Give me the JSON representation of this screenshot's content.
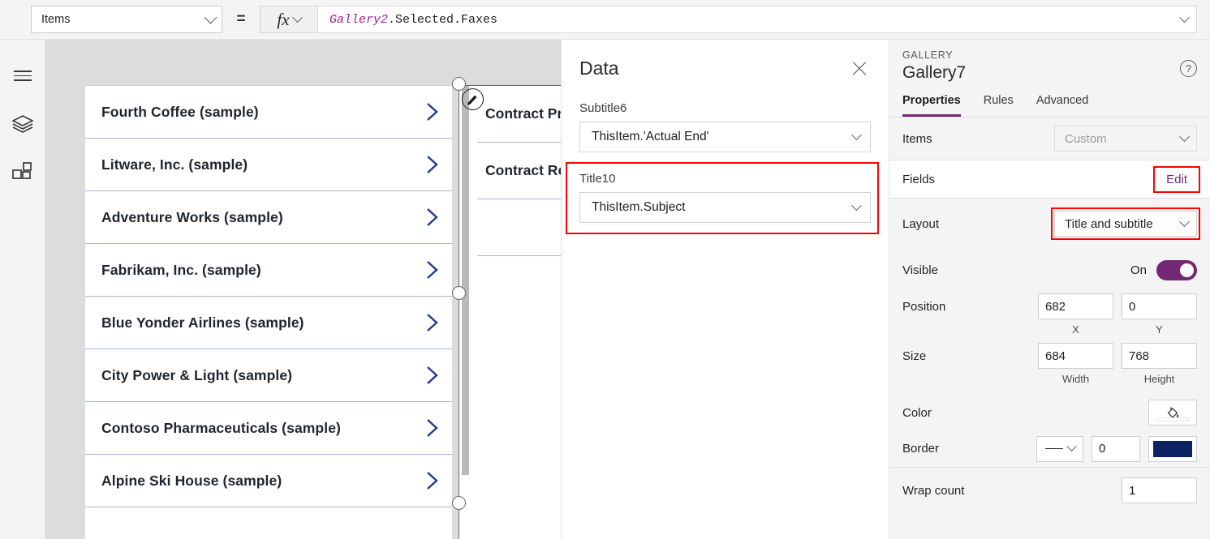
{
  "formula_bar": {
    "property_selector": {
      "value": "Items",
      "icon": "chevron-down-icon"
    },
    "equals": "=",
    "fx_label": "fx",
    "formula": {
      "object": "Gallery2",
      "rest": ".Selected.Faxes"
    }
  },
  "left_rail": {
    "items": [
      {
        "icon": "hamburger-menu-icon",
        "name": "menu"
      },
      {
        "icon": "layers-icon",
        "name": "screens"
      },
      {
        "icon": "components-grid-icon",
        "name": "components"
      }
    ]
  },
  "canvas": {
    "gallery1": {
      "items": [
        {
          "title": "Fourth Coffee (sample)"
        },
        {
          "title": "Litware, Inc. (sample)"
        },
        {
          "title": "Adventure Works (sample)"
        },
        {
          "title": "Fabrikam, Inc. (sample)"
        },
        {
          "title": "Blue Yonder Airlines (sample)"
        },
        {
          "title": "City Power & Light (sample)"
        },
        {
          "title": "Contoso Pharmaceuticals (sample)"
        },
        {
          "title": "Alpine Ski House (sample)"
        }
      ],
      "chevron_color": "#1f3a93"
    },
    "gallery2": {
      "selected": true,
      "items": [
        {
          "title": "Contract Pro"
        },
        {
          "title": "Contract Rev"
        },
        {
          "title": ""
        }
      ],
      "edit_badge_icon": "pencil-edit-icon"
    }
  },
  "data_panel": {
    "title": "Data",
    "close_icon": "close-icon",
    "fields": [
      {
        "label": "Subtitle6",
        "value": "ThisItem.'Actual End'",
        "highlighted": false
      },
      {
        "label": "Title10",
        "value": "ThisItem.Subject",
        "highlighted": true
      }
    ]
  },
  "properties_panel": {
    "kind": "GALLERY",
    "name": "Gallery7",
    "help_icon": "help-question-icon",
    "tabs": [
      {
        "label": "Properties",
        "active": true
      },
      {
        "label": "Rules",
        "active": false
      },
      {
        "label": "Advanced",
        "active": false
      }
    ],
    "rows": {
      "items": {
        "label": "Items",
        "value": "Custom"
      },
      "fields": {
        "label": "Fields",
        "action": "Edit"
      },
      "layout": {
        "label": "Layout",
        "value": "Title and subtitle"
      },
      "visible": {
        "label": "Visible",
        "state": "On"
      },
      "position": {
        "label": "Position",
        "x": "682",
        "y": "0",
        "x_caption": "X",
        "y_caption": "Y"
      },
      "size": {
        "label": "Size",
        "width": "684",
        "height": "768",
        "width_caption": "Width",
        "height_caption": "Height"
      },
      "color": {
        "label": "Color",
        "icon": "paint-bucket-icon"
      },
      "border": {
        "label": "Border",
        "style_icon": "solid-line-icon",
        "thickness": "0",
        "color_hex": "#0b2265"
      },
      "wrap_count": {
        "label": "Wrap count",
        "value": "1"
      }
    },
    "accent_color": "#742774",
    "highlight_color": "#ff0000"
  }
}
